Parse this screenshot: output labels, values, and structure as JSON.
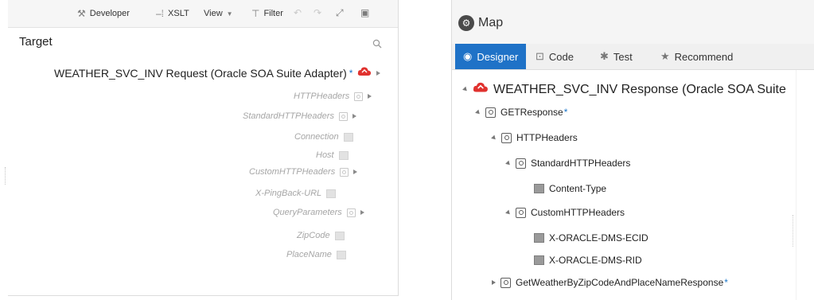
{
  "toolbar": {
    "developer": "Developer",
    "xslt": "XSLT",
    "view": "View",
    "filter": "Filter"
  },
  "target": {
    "title": "Target",
    "root": "WEATHER_SVC_INV Request (Oracle SOA Suite Adapter)",
    "root_star": "*",
    "items": [
      "HTTPHeaders",
      "StandardHTTPHeaders",
      "Connection",
      "Host",
      "CustomHTTPHeaders",
      "X-PingBack-URL",
      "QueryParameters",
      "ZipCode",
      "PlaceName"
    ]
  },
  "map": {
    "title": "Map",
    "tabs": [
      "Designer",
      "Code",
      "Test",
      "Recommend"
    ],
    "root": "WEATHER_SVC_INV Response (Oracle SOA Suite",
    "items": [
      "GETResponse",
      "HTTPHeaders",
      "StandardHTTPHeaders",
      "Content-Type",
      "CustomHTTPHeaders",
      "X-ORACLE-DMS-ECID",
      "X-ORACLE-DMS-RID",
      "GetWeatherByZipCodeAndPlaceNameResponse"
    ],
    "star": "*"
  },
  "colors": {
    "accent": "#1f72c7",
    "adapter_red": "#e0322f"
  }
}
